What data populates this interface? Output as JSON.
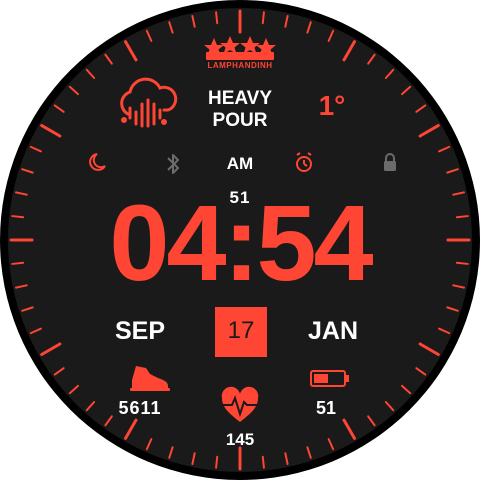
{
  "colors": {
    "accent": "#ff4533",
    "face": "#1a1a1a",
    "text": "#ffffff",
    "bezel": "#000000",
    "dim_icon": "#6b6b6b"
  },
  "brand": {
    "text": "LAMPHANDINH",
    "logo": "stars-crown-icon"
  },
  "weather": {
    "condition": "HEAVY\nPOUR",
    "temperature": "1°",
    "icon": "cloud-rain-icon"
  },
  "status_icons": [
    "moon-icon",
    "bluetooth-icon",
    "alarm-icon",
    "lock-icon"
  ],
  "time": {
    "ampm": "AM",
    "seconds": "51",
    "display": "04:54"
  },
  "date": {
    "month_left": "SEP",
    "day": "17",
    "month_right": "JAN"
  },
  "stats": {
    "steps": "5611",
    "steps_icon": "shoe-icon",
    "battery": "51",
    "battery_icon": "battery-icon",
    "heart_rate": "145",
    "heart_icon": "heart-pulse-icon"
  }
}
